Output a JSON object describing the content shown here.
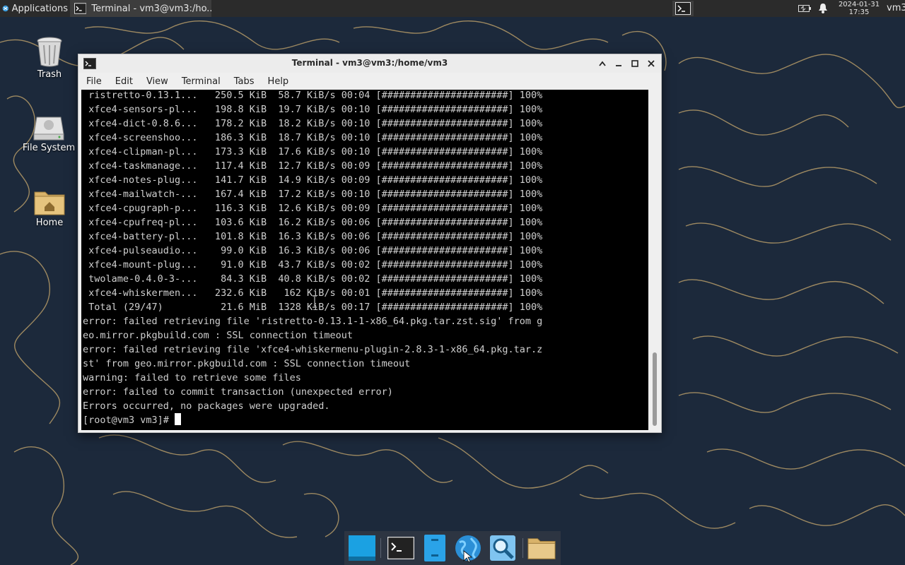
{
  "top_panel": {
    "applications_label": "Applications",
    "task_label": "Terminal - vm3@vm3:/ho...",
    "clock_date": "2024-01-31",
    "clock_time": "17:35",
    "user": "vm3"
  },
  "desktop_icons": [
    {
      "label": "Trash",
      "icon": "trash-icon"
    },
    {
      "label": "File System",
      "icon": "drive-icon"
    },
    {
      "label": "Home",
      "icon": "home-folder-icon"
    }
  ],
  "window": {
    "title": "Terminal - vm3@vm3:/home/vm3",
    "menu": [
      "File",
      "Edit",
      "View",
      "Terminal",
      "Tabs",
      "Help"
    ]
  },
  "terminal": {
    "lines": [
      " ristretto-0.13.1...   250.5 KiB  58.7 KiB/s 00:04 [######################] 100%",
      " xfce4-sensors-pl...   198.8 KiB  19.7 KiB/s 00:10 [######################] 100%",
      " xfce4-dict-0.8.6...   178.2 KiB  18.2 KiB/s 00:10 [######################] 100%",
      " xfce4-screenshoo...   186.3 KiB  18.7 KiB/s 00:10 [######################] 100%",
      " xfce4-clipman-pl...   173.3 KiB  17.6 KiB/s 00:10 [######################] 100%",
      " xfce4-taskmanage...   117.4 KiB  12.7 KiB/s 00:09 [######################] 100%",
      " xfce4-notes-plug...   141.7 KiB  14.9 KiB/s 00:09 [######################] 100%",
      " xfce4-mailwatch-...   167.4 KiB  17.2 KiB/s 00:10 [######################] 100%",
      " xfce4-cpugraph-p...   116.3 KiB  12.6 KiB/s 00:09 [######################] 100%",
      " xfce4-cpufreq-pl...   103.6 KiB  16.2 KiB/s 00:06 [######################] 100%",
      " xfce4-battery-pl...   101.8 KiB  16.3 KiB/s 00:06 [######################] 100%",
      " xfce4-pulseaudio...    99.0 KiB  16.3 KiB/s 00:06 [######################] 100%",
      " xfce4-mount-plug...    91.0 KiB  43.7 KiB/s 00:02 [######################] 100%",
      " twolame-0.4.0-3-...    84.3 KiB  40.8 KiB/s 00:02 [######################] 100%",
      " xfce4-whiskermen...   232.6 KiB   162 KiB/s 00:01 [######################] 100%",
      " Total (29/47)          21.6 MiB  1328 KiB/s 00:17 [######################] 100%",
      "error: failed retrieving file 'ristretto-0.13.1-1-x86_64.pkg.tar.zst.sig' from g",
      "eo.mirror.pkgbuild.com : SSL connection timeout",
      "error: failed retrieving file 'xfce4-whiskermenu-plugin-2.8.3-1-x86_64.pkg.tar.z",
      "st' from geo.mirror.pkgbuild.com : SSL connection timeout",
      "warning: failed to retrieve some files",
      "error: failed to commit transaction (unexpected error)",
      "Errors occurred, no packages were upgraded."
    ],
    "prompt": "[root@vm3 vm3]# "
  },
  "dock": [
    "desktop-icon",
    "terminal-icon",
    "file-manager-icon",
    "web-browser-icon",
    "app-finder-icon",
    "folder-icon"
  ],
  "colors": {
    "terminal_bg": "#000000",
    "terminal_fg": "#cfcfcf",
    "panel_bg": "#2b2b2b",
    "window_chrome": "#efefef"
  }
}
